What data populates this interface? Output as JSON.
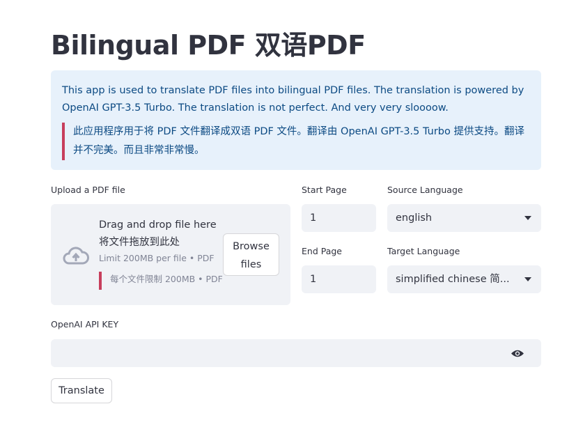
{
  "title": "Bilingual PDF 双语PDF",
  "info": {
    "en": "This app is used to translate PDF files into bilingual PDF files. The translation is powered by OpenAI GPT-3.5 Turbo. The translation is not perfect. And very very sloooow.",
    "zh": "此应用程序用于将 PDF 文件翻译成双语 PDF 文件。翻译由 OpenAI GPT-3.5 Turbo 提供支持。翻译并不完美。而且非常非常慢。"
  },
  "uploader": {
    "label": "Upload a PDF file",
    "drag_text": "Drag and drop file here 将文件拖放到此处",
    "limit": "Limit 200MB per file • PDF",
    "limit_zh": "每个文件限制 200MB • PDF",
    "browse": "Browse files",
    "icon": "cloud-upload-icon"
  },
  "start_page": {
    "label": "Start Page",
    "value": "1"
  },
  "end_page": {
    "label": "End Page",
    "value": "1"
  },
  "source_language": {
    "label": "Source Language",
    "value": "english"
  },
  "target_language": {
    "label": "Target Language",
    "value": "simplified chinese 简..."
  },
  "api_key": {
    "label": "OpenAI API KEY",
    "value": "",
    "icon": "eye-icon"
  },
  "translate_button": "Translate",
  "colors": {
    "info_bg": "#e7f1fb",
    "info_text": "#0c4a83",
    "accent_red": "#c73e5c",
    "input_bg": "#f0f2f6"
  }
}
